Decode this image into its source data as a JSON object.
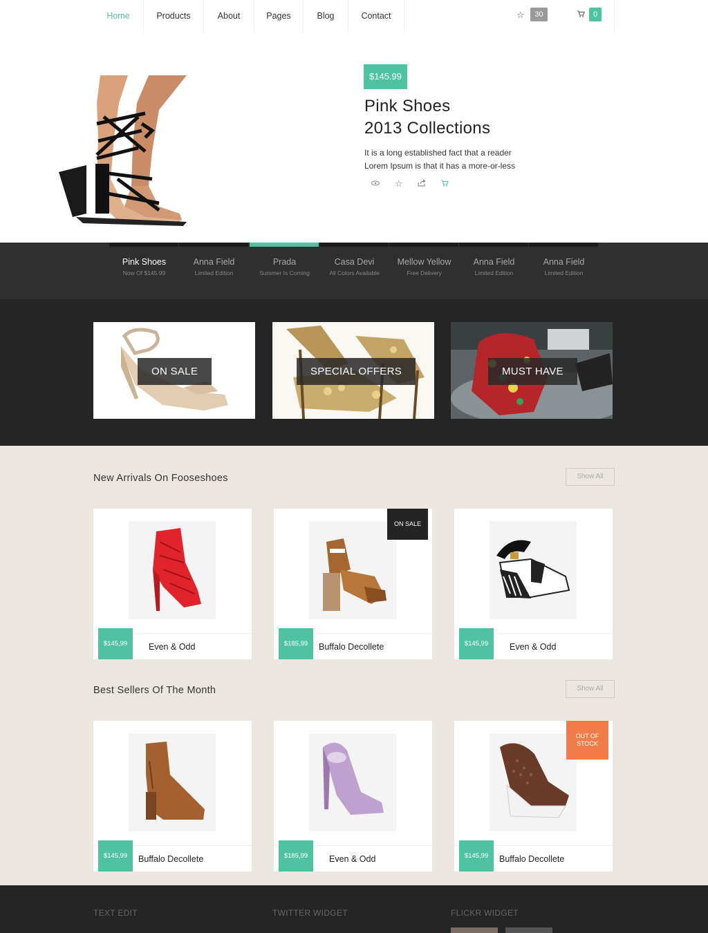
{
  "nav": {
    "items": [
      "Home",
      "Products",
      "About",
      "Pages",
      "Blog",
      "Contact"
    ],
    "wishlist_count": "30",
    "cart_count": "0"
  },
  "hero": {
    "price": "$145.99",
    "title_line1": "Pink Shoes",
    "title_line2": "2013 Collections",
    "desc_line1": "It is a long established fact that a reader",
    "desc_line2": "Lorem Ipsum is that it has a more-or-less"
  },
  "tabs": [
    {
      "title": "Pink Shoes",
      "sub": "Now Of $145.99"
    },
    {
      "title": "Anna Field",
      "sub": "Limited Edition"
    },
    {
      "title": "Prada",
      "sub": "Summer Is Coming"
    },
    {
      "title": "Casa Devi",
      "sub": "All Colors Available"
    },
    {
      "title": "Mellow Yellow",
      "sub": "Free Delivery"
    },
    {
      "title": "Anna Field",
      "sub": "Limited Edition"
    },
    {
      "title": "Anna Field",
      "sub": "Limited Edition"
    }
  ],
  "promo": [
    "ON SALE",
    "SPECIAL OFFERS",
    "MUST HAVE"
  ],
  "new_arrivals": {
    "title": "New Arrivals On Fooseshoes",
    "show_all": "Show All",
    "items": [
      {
        "price": "$145,99",
        "name": "Even & Odd"
      },
      {
        "price": "$185,99",
        "name": "Buffalo Decollete",
        "badge": "ON SALE"
      },
      {
        "price": "$145,99",
        "name": "Even & Odd"
      }
    ]
  },
  "best_sellers": {
    "title": "Best Sellers Of The Month",
    "show_all": "Show All",
    "items": [
      {
        "price": "$145,99",
        "name": "Buffalo Decollete"
      },
      {
        "price": "$185,99",
        "name": "Even & Odd"
      },
      {
        "price": "$145,99",
        "name": "Buffalo Decollete",
        "badge_line1": "OUT OF",
        "badge_line2": "STOCK"
      }
    ]
  },
  "footer": {
    "col1_title": "TEXT EDIT",
    "col2_title": "TWITTER WIDGET",
    "col3_title": "FLICKR WIDGET"
  },
  "colors": {
    "accent": "#4fc3a1",
    "dark": "#252525",
    "orange": "#f27b4a",
    "beige": "#ebe6e0"
  }
}
